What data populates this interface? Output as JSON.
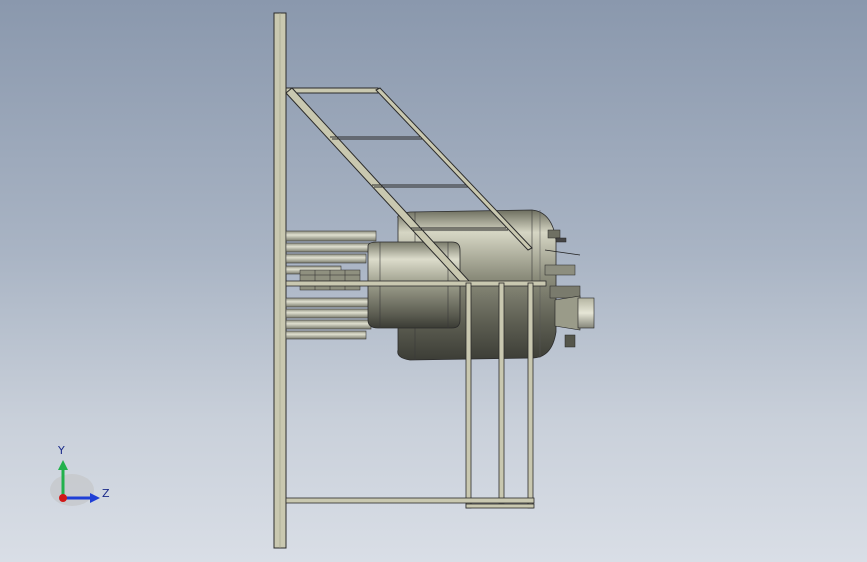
{
  "view": {
    "background_top": "#8a98ad",
    "background_bottom": "#d9dee6",
    "model_fill": "#c8c7ae",
    "model_stroke": "#2b2b2b"
  },
  "triad": {
    "y_label": "Y",
    "z_label": "Z",
    "y_color": "#22b14c",
    "z_color": "#1f3fd6",
    "x_color": "#d01818"
  }
}
